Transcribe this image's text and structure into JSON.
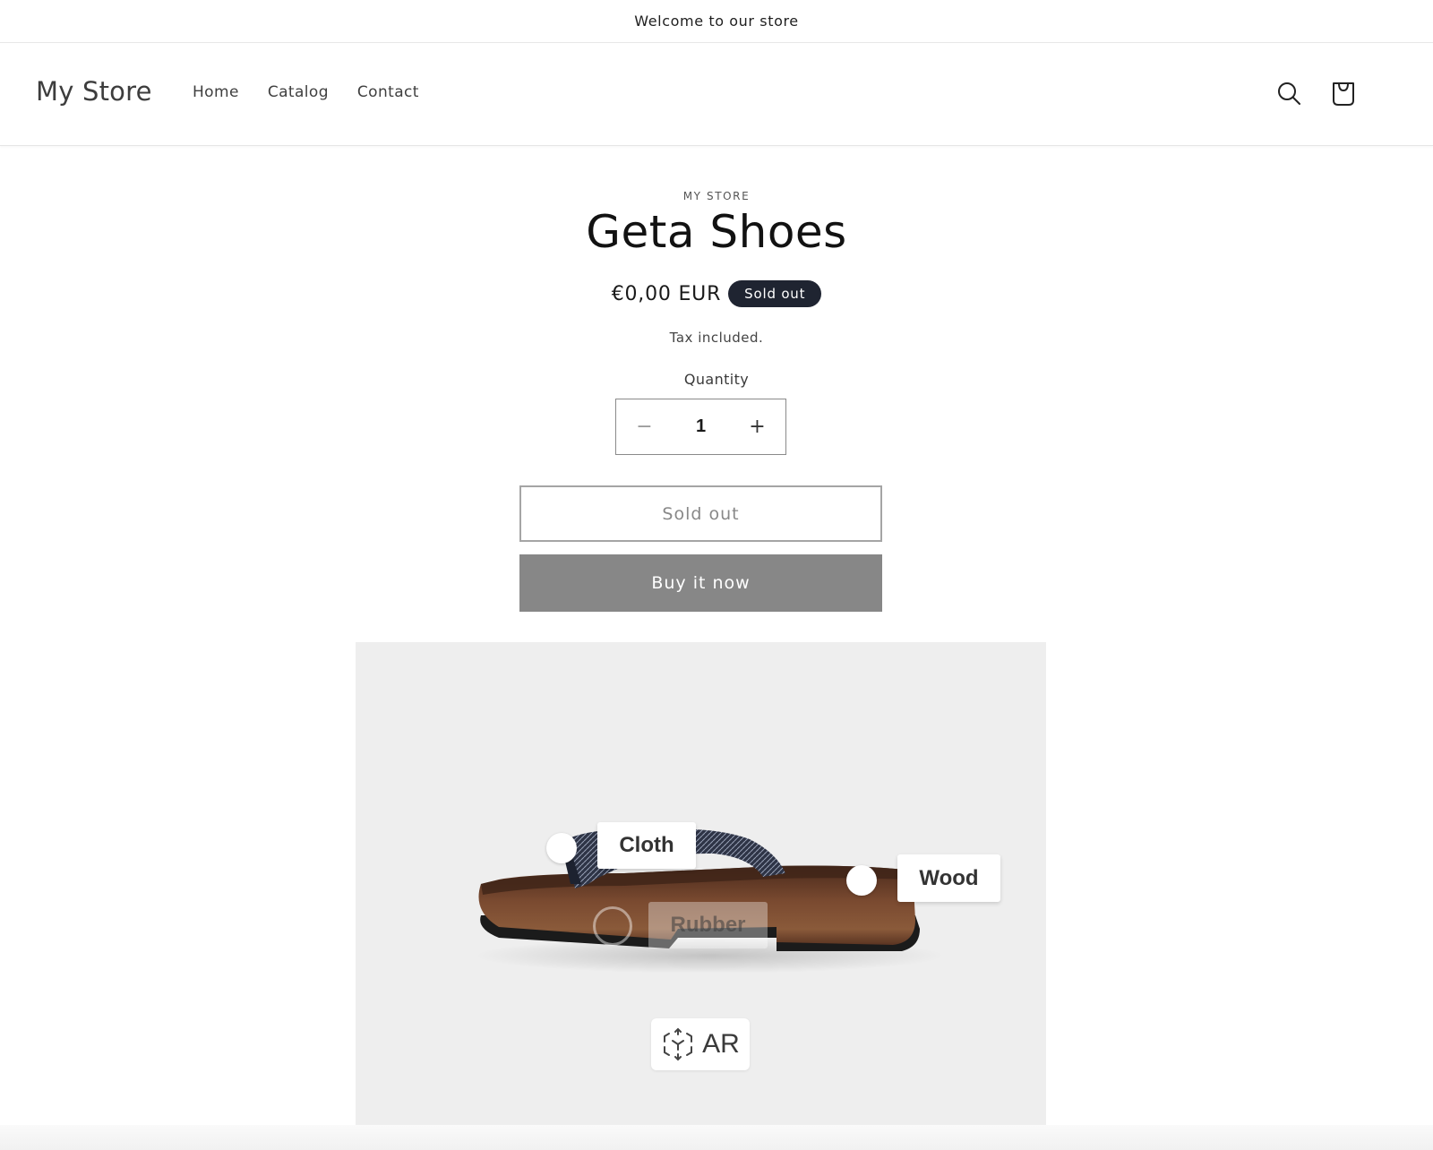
{
  "announcement": {
    "text": "Welcome to our store"
  },
  "header": {
    "logo": "My Store",
    "nav": [
      {
        "label": "Home"
      },
      {
        "label": "Catalog"
      },
      {
        "label": "Contact"
      }
    ],
    "icons": {
      "search": "search-icon",
      "cart": "cart-icon"
    }
  },
  "product": {
    "vendor": "MY STORE",
    "title": "Geta Shoes",
    "price": "€0,00 EUR",
    "badge": "Sold out",
    "tax_note": "Tax included.",
    "quantity_label": "Quantity",
    "quantity_value": "1",
    "decrease_symbol": "−",
    "increase_symbol": "+",
    "add_to_cart_label": "Sold out",
    "buy_now_label": "Buy it now"
  },
  "viewer": {
    "hotspots": [
      {
        "label": "Cloth"
      },
      {
        "label": "Wood"
      },
      {
        "label": "Rubber"
      }
    ],
    "ar_label": "AR"
  },
  "colors": {
    "badge_bg": "#1f2431",
    "buy_button_bg": "#878787",
    "viewer_bg": "#eeeeee"
  }
}
